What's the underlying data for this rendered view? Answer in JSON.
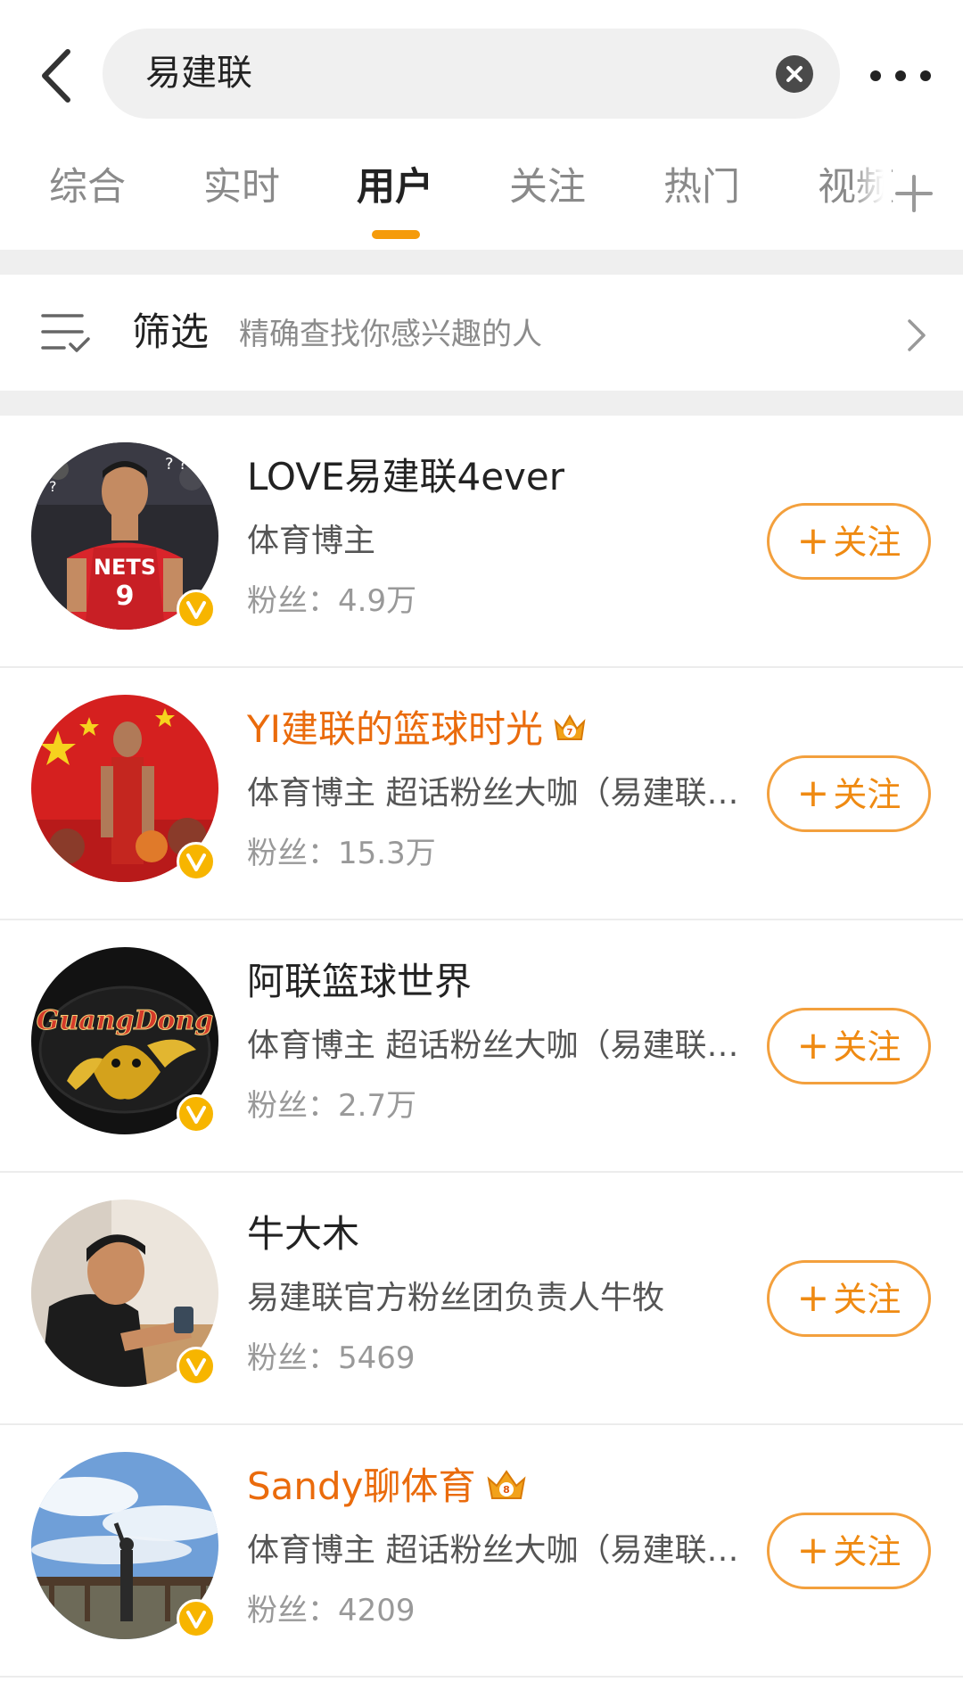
{
  "search": {
    "query": "易建联"
  },
  "tabs": [
    {
      "label": "综合"
    },
    {
      "label": "实时"
    },
    {
      "label": "用户"
    },
    {
      "label": "关注"
    },
    {
      "label": "热门"
    },
    {
      "label": "视频"
    }
  ],
  "active_tab": "用户",
  "filter": {
    "label": "筛选",
    "hint": "精确查找你感兴趣的人"
  },
  "users": [
    {
      "name": "LOVE易建联4ever",
      "desc": "体育博主",
      "fans": "粉丝：4.9万",
      "follow": "关注",
      "vip": false
    },
    {
      "name": "YI建联的篮球时光",
      "desc": "体育博主 超话粉丝大咖（易建联超...",
      "fans": "粉丝：15.3万",
      "follow": "关注",
      "vip": true,
      "crown_level": "7"
    },
    {
      "name": "阿联篮球世界",
      "desc": "体育博主 超话粉丝大咖（易建联超...",
      "fans": "粉丝：2.7万",
      "follow": "关注",
      "vip": false,
      "avatar_text": "GuangDong"
    },
    {
      "name": "牛大木",
      "desc": "易建联官方粉丝团负责人牛牧",
      "fans": "粉丝：5469",
      "follow": "关注",
      "vip": false
    },
    {
      "name": "Sandy聊体育",
      "desc": "体育博主 超话粉丝大咖（易建联超...",
      "fans": "粉丝：4209",
      "follow": "关注",
      "vip": true,
      "crown_level": "8"
    }
  ],
  "jersey": {
    "team": "NETS",
    "number": "9"
  },
  "colors": {
    "accent": "#f59b0b",
    "vip_name": "#ea6b0c",
    "follow_border": "#f3a03d",
    "badge": "#f7b500"
  },
  "icons": {
    "back": "chevron-left-icon",
    "clear": "clear-icon",
    "more": "more-icon",
    "filter": "filter-icon",
    "add_tab": "plus-icon",
    "verified": "verified-icon",
    "crown": "crown-icon"
  }
}
